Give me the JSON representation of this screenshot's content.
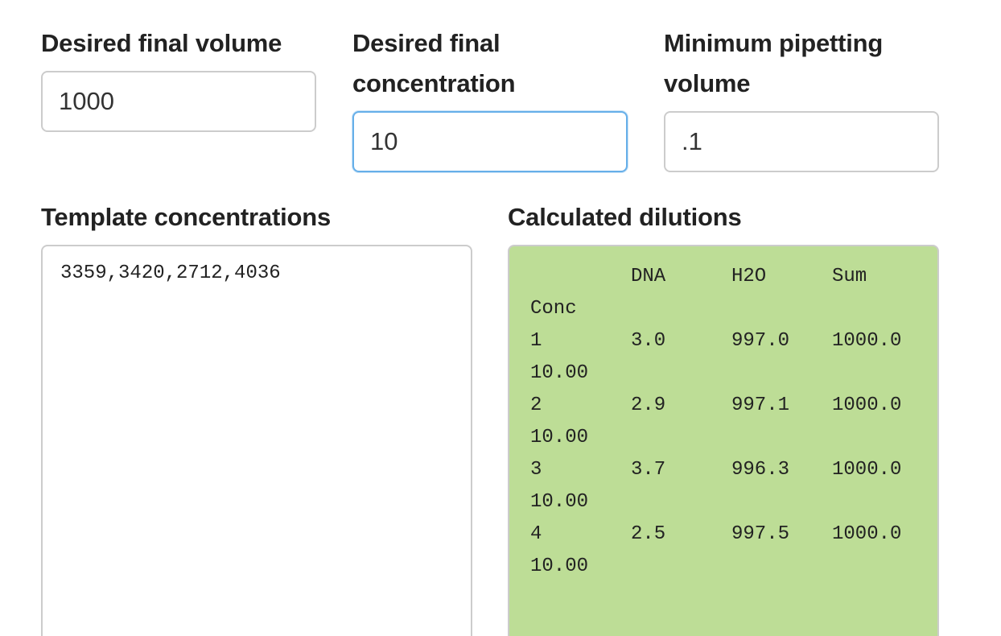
{
  "fields": {
    "final_volume": {
      "label": "Desired final volume",
      "value": "1000"
    },
    "final_concentration": {
      "label_line1": "Desired final",
      "label_line2": "concentration",
      "value": "10"
    },
    "min_pipetting": {
      "label_line1": "Minimum pipetting",
      "label_line2": "volume",
      "value": ".1"
    }
  },
  "templates": {
    "label": "Template concentrations",
    "value": "3359,3420,2712,4036"
  },
  "results": {
    "label": "Calculated dilutions",
    "header": [
      "",
      "DNA",
      "H2O",
      "Sum"
    ],
    "header_wrap": "Conc",
    "rows": [
      {
        "id": "1",
        "dna": "3.0",
        "h2o": "997.0",
        "sum": "1000.0",
        "conc": "10.00"
      },
      {
        "id": "2",
        "dna": "2.9",
        "h2o": "997.1",
        "sum": "1000.0",
        "conc": "10.00"
      },
      {
        "id": "3",
        "dna": "3.7",
        "h2o": "996.3",
        "sum": "1000.0",
        "conc": "10.00"
      },
      {
        "id": "4",
        "dna": "2.5",
        "h2o": "997.5",
        "sum": "1000.0",
        "conc": "10.00"
      }
    ],
    "background_color": "#bddd96"
  },
  "colors": {
    "focus_border": "#66afe9",
    "input_border": "#cccccc"
  }
}
